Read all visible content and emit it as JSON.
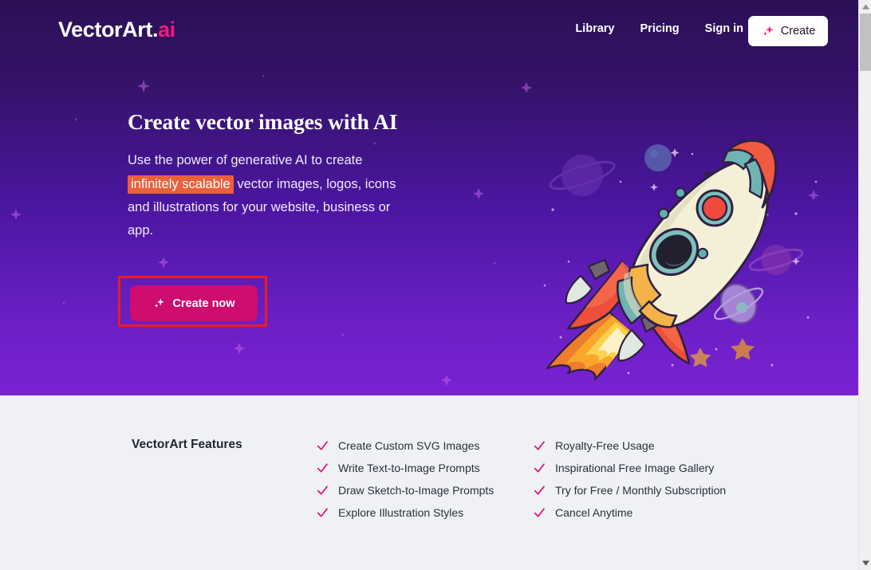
{
  "brand": {
    "logo_main": "VectorArt",
    "logo_dot": ".",
    "logo_ai": "ai",
    "accent_pink": "#f5197e",
    "accent_magenta": "#cf0d6e",
    "highlight_orange": "#e9603b",
    "hero_gradient_top": "#2b1055",
    "hero_gradient_bottom": "#7a22d4",
    "features_bg": "#f0f1f5",
    "annotation_red": "#ef1b1b"
  },
  "nav": {
    "links": [
      {
        "label": "Library"
      },
      {
        "label": "Pricing"
      },
      {
        "label": "Sign in"
      }
    ],
    "create_button": {
      "label": "Create",
      "icon": "sparkle-icon"
    }
  },
  "hero": {
    "title": "Create vector images with AI",
    "subtitle_part1": "Use the power of generative AI to create ",
    "subtitle_highlight": "infinitely scalable",
    "subtitle_part2": " vector images, logos, icons and illustrations for your website, business or app.",
    "cta": {
      "label": "Create now",
      "icon": "sparkle-icon"
    },
    "illustration": "rocket-illustration"
  },
  "features": {
    "heading": "VectorArt Features",
    "check_icon": "check-icon",
    "columns": [
      {
        "items": [
          {
            "label": "Create Custom SVG Images"
          },
          {
            "label": "Write Text-to-Image Prompts"
          },
          {
            "label": "Draw Sketch-to-Image Prompts"
          },
          {
            "label": "Explore Illustration Styles"
          }
        ]
      },
      {
        "items": [
          {
            "label": "Royalty-Free Usage"
          },
          {
            "label": "Inspirational Free Image Gallery"
          },
          {
            "label": "Try for Free / Monthly Subscription"
          },
          {
            "label": "Cancel Anytime"
          }
        ]
      }
    ]
  },
  "scrollbar": {
    "up_arrow": "▲",
    "down_arrow": "▼"
  }
}
